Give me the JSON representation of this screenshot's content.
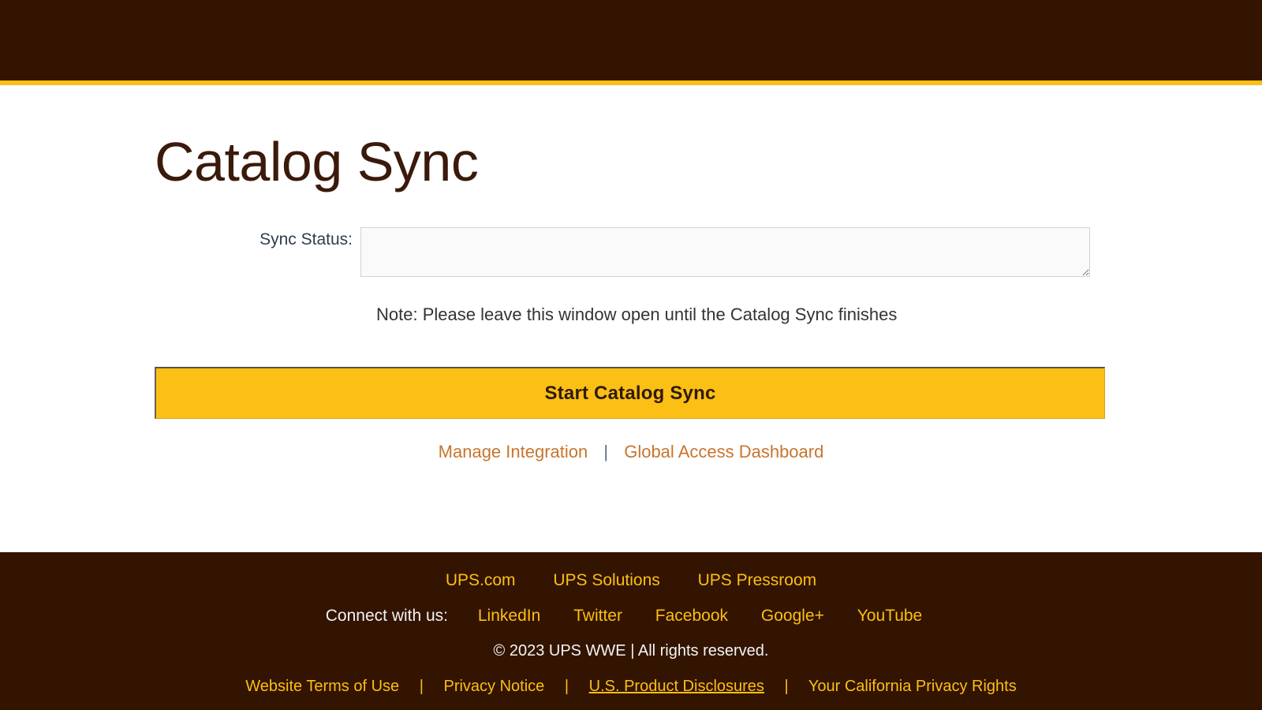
{
  "header": {
    "accent_color": "#fbbf15",
    "background_color": "#331400"
  },
  "main": {
    "title": "Catalog Sync",
    "form": {
      "status_label": "Sync Status:",
      "status_value": "",
      "status_placeholder": ""
    },
    "note": "Note: Please leave this window open until the Catalog Sync finishes",
    "primary_action": "Start Catalog Sync",
    "links": [
      {
        "label": "Manage Integration"
      },
      {
        "label": "Global Access Dashboard"
      }
    ],
    "link_separator": "|"
  },
  "footer": {
    "primary_links": [
      {
        "label": "UPS.com"
      },
      {
        "label": "UPS Solutions"
      },
      {
        "label": "UPS Pressroom"
      }
    ],
    "connect_label": "Connect with us:",
    "social_links": [
      {
        "label": "LinkedIn"
      },
      {
        "label": "Twitter"
      },
      {
        "label": "Facebook"
      },
      {
        "label": "Google+"
      },
      {
        "label": "YouTube"
      }
    ],
    "copyright": "© 2023 UPS WWE | All rights reserved.",
    "legal_links": [
      {
        "label": "Website Terms of Use",
        "underlined": false
      },
      {
        "label": "Privacy Notice",
        "underlined": false
      },
      {
        "label": "U.S. Product Disclosures",
        "underlined": true
      },
      {
        "label": "Your California Privacy Rights",
        "underlined": false
      }
    ],
    "legal_separator": "|"
  }
}
